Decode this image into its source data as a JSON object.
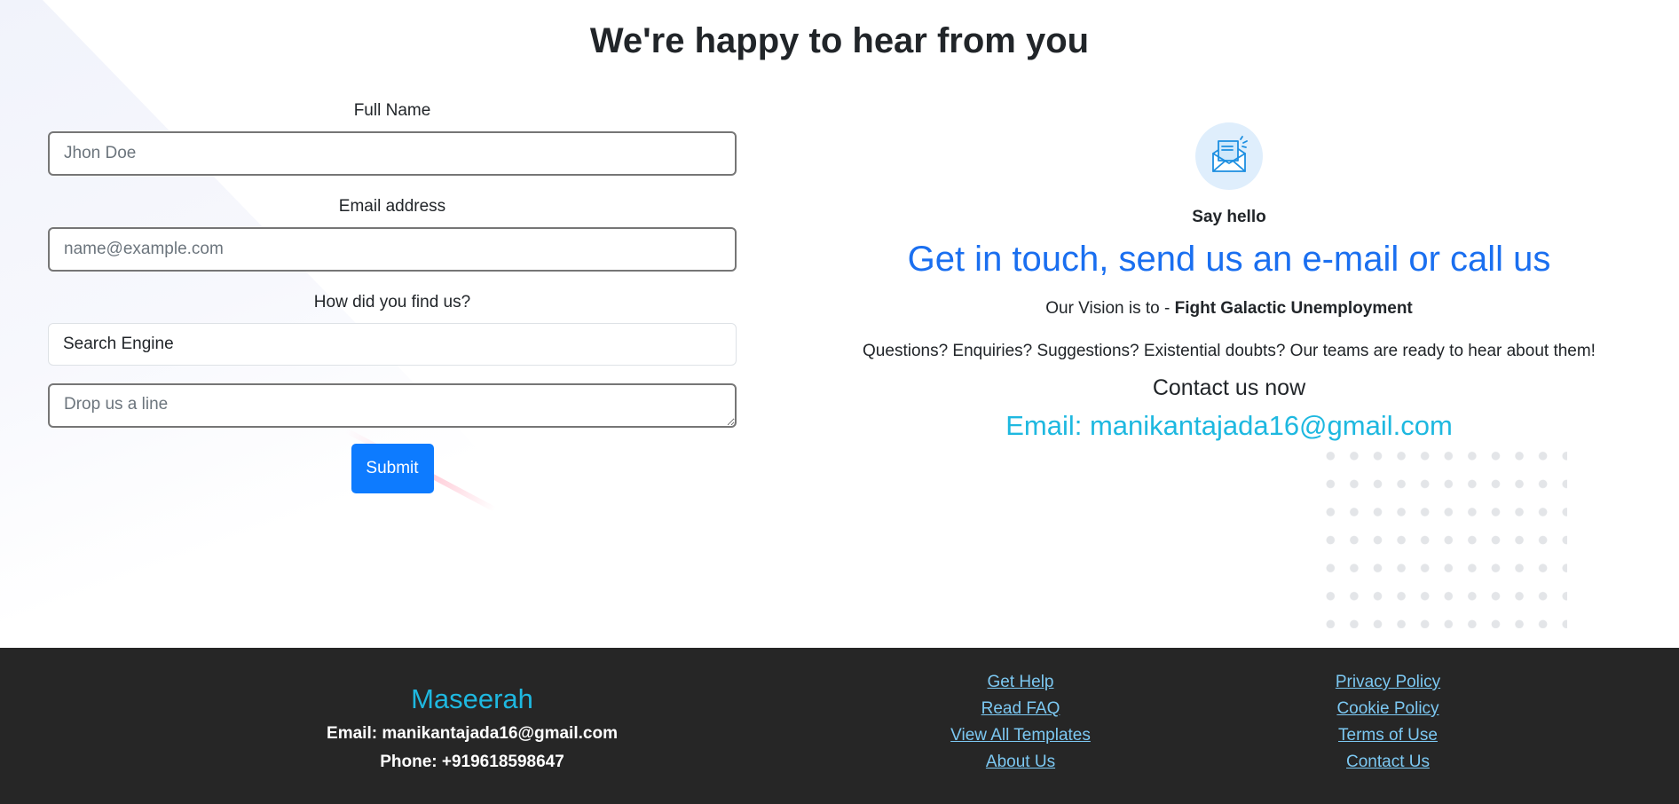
{
  "page": {
    "title": "We're happy to hear from you"
  },
  "form": {
    "full_name_label": "Full Name",
    "full_name_placeholder": "Jhon Doe",
    "email_label": "Email address",
    "email_placeholder": "name@example.com",
    "find_us_label": "How did you find us?",
    "find_us_value": "Search Engine",
    "message_placeholder": "Drop us a line",
    "submit_label": "Submit"
  },
  "info": {
    "icon": "mail-open-icon",
    "say_hello": "Say hello",
    "heading": "Get in touch, send us an e-mail or call us",
    "vision_prefix": "Our Vision is to -",
    "vision_bold": "Fight Galactic Unemployment",
    "questions": "Questions? Enquiries? Suggestions? Existential doubts? Our teams are ready to hear about them!",
    "contact_now": "Contact us now",
    "contact_email": "Email: manikantajada16@gmail.com"
  },
  "footer": {
    "brand": "Maseerah",
    "email": "Email: manikantajada16@gmail.com",
    "phone": "Phone: +919618598647",
    "links_col1": [
      "Get Help",
      "Read FAQ",
      "View All Templates",
      "About Us"
    ],
    "links_col2": [
      "Privacy Policy",
      "Cookie Policy",
      "Terms of Use",
      "Contact Us"
    ]
  },
  "colors": {
    "primary_button": "#0d7bff",
    "heading_blue": "#1a6ff0",
    "accent_cyan": "#1eb8e0",
    "footer_bg": "#262626",
    "footer_link": "#7cc8f2"
  }
}
